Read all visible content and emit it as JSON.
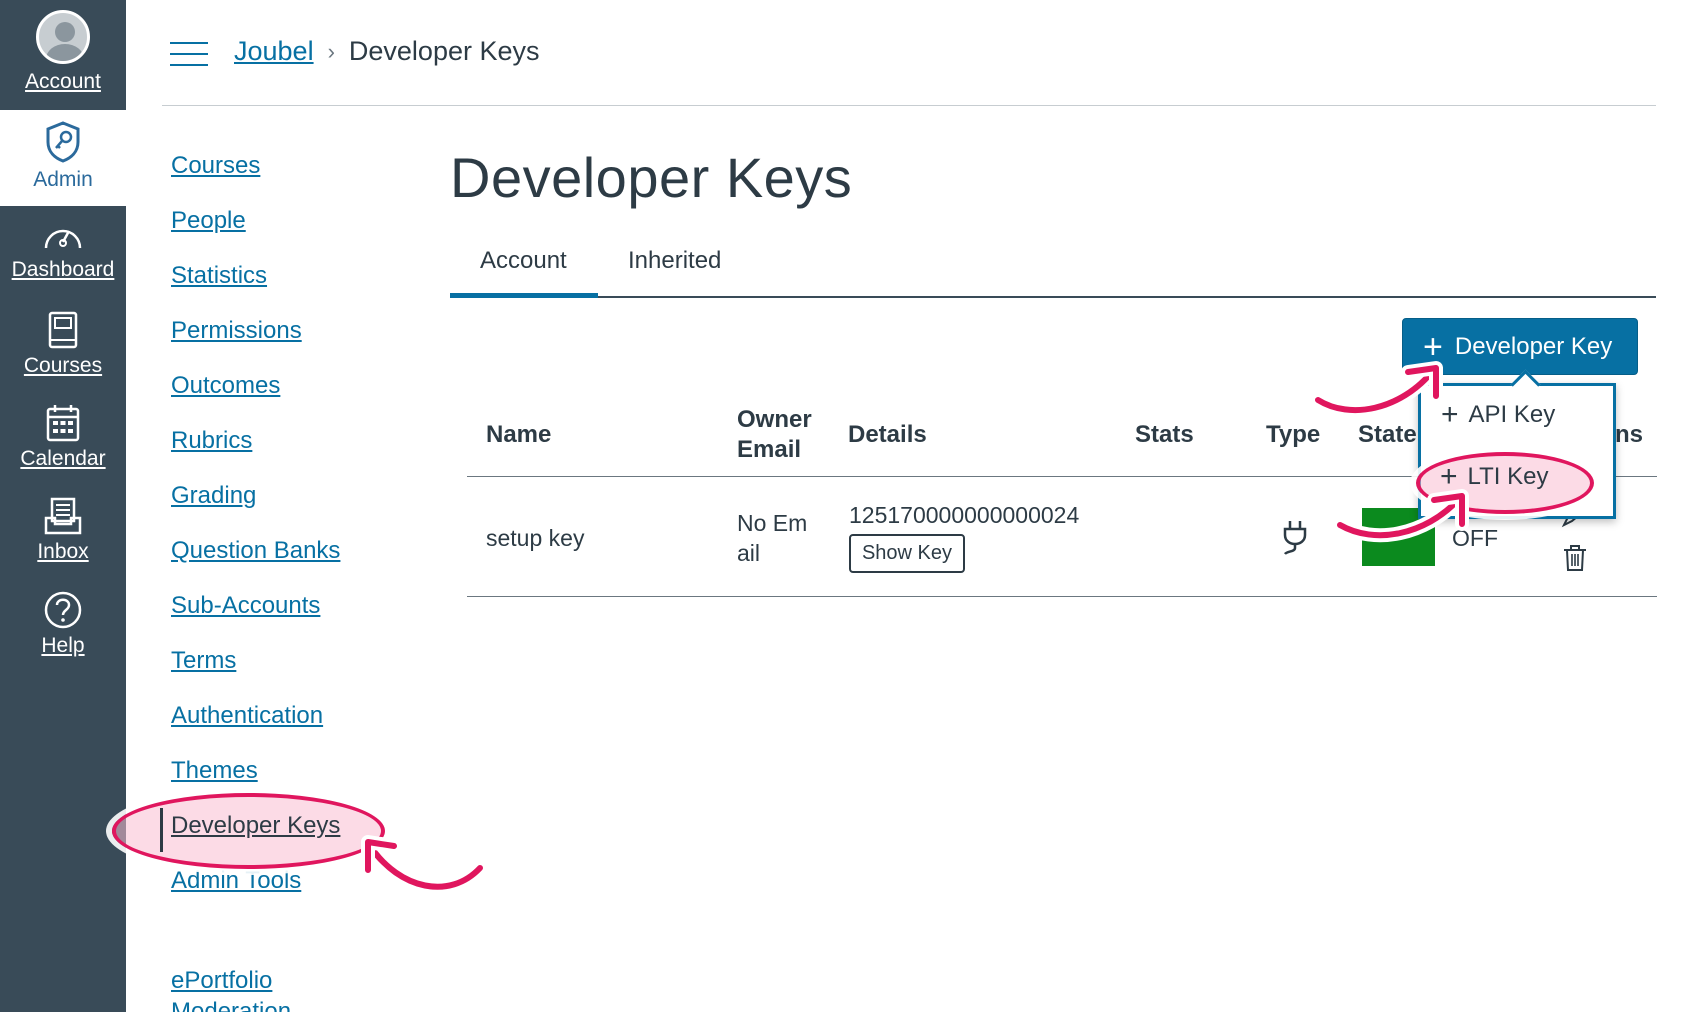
{
  "global_nav": {
    "account": "Account",
    "admin": "Admin",
    "dashboard": "Dashboard",
    "courses": "Courses",
    "calendar": "Calendar",
    "inbox": "Inbox",
    "help": "Help"
  },
  "breadcrumb": {
    "account": "Joubel",
    "current": "Developer Keys",
    "separator": "›"
  },
  "left_menu": [
    "Courses",
    "People",
    "Statistics",
    "Permissions",
    "Outcomes",
    "Rubrics",
    "Grading",
    "Question Banks",
    "Sub-Accounts",
    "Terms",
    "Authentication",
    "Themes",
    "Developer Keys",
    "Admin Tools",
    "ePortfolio",
    "Moderation"
  ],
  "page": {
    "title": "Developer Keys",
    "tabs": [
      "Account",
      "Inherited"
    ],
    "active_tab": "Account",
    "add_button": "Developer Key",
    "dropdown": {
      "api_key": "API Key",
      "lti_key": "LTI Key"
    }
  },
  "table": {
    "headers": {
      "name": "Name",
      "owner_line1": "Owner",
      "owner_line2": "Email",
      "details": "Details",
      "stats": "Stats",
      "type": "Type",
      "state": "State",
      "actions_tail": "ns"
    },
    "rows": [
      {
        "name": "setup key",
        "owner_line1": "No Em",
        "owner_line2": "ail",
        "key_id": "125170000000000024",
        "show_key": "Show Key",
        "state_tail": "OFF",
        "type_icon": "plug-icon"
      }
    ]
  },
  "colors": {
    "nav_bg": "#394b58",
    "link": "#0770a3",
    "primary": "#0770a3",
    "toggle_on": "#0b8a1e",
    "highlight": "#e0165e"
  }
}
